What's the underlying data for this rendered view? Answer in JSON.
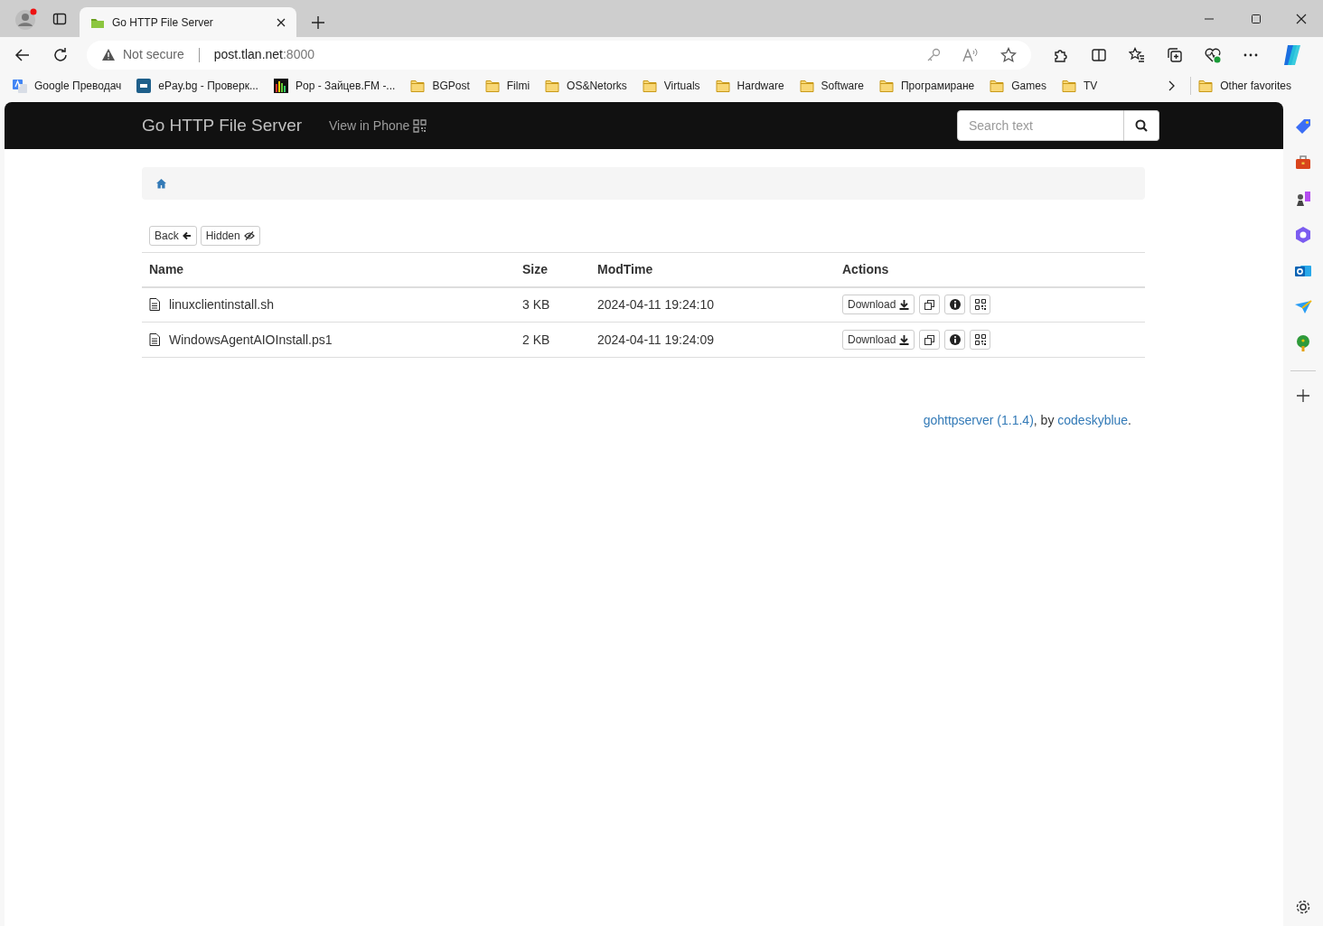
{
  "browser": {
    "tab_title": "Go HTTP File Server",
    "security": "Not secure",
    "url_host": "post.tlan.net",
    "url_port": ":8000",
    "bookmarks": [
      {
        "kind": "translate",
        "label": "Google Преводач"
      },
      {
        "kind": "epay",
        "label": "ePay.bg - Проверк..."
      },
      {
        "kind": "equalizer",
        "label": "Pop - Зайцев.FM -..."
      },
      {
        "kind": "folder",
        "label": "BGPost"
      },
      {
        "kind": "folder",
        "label": "Filmi"
      },
      {
        "kind": "folder",
        "label": "OS&Netorks"
      },
      {
        "kind": "folder",
        "label": "Virtuals"
      },
      {
        "kind": "folder",
        "label": "Hardware"
      },
      {
        "kind": "folder",
        "label": "Software"
      },
      {
        "kind": "folder",
        "label": "Програмиране"
      },
      {
        "kind": "folder",
        "label": "Games"
      },
      {
        "kind": "folder",
        "label": "TV"
      }
    ],
    "other_favorites": "Other favorites"
  },
  "navbar": {
    "brand": "Go HTTP File Server",
    "view_in_phone": "View in Phone",
    "search": {
      "placeholder": "Search text"
    }
  },
  "toolbar": [
    "Back",
    "Hidden"
  ],
  "table": {
    "columns": [
      "Name",
      "Size",
      "ModTime",
      "Actions"
    ],
    "rows": [
      {
        "name": "linuxclientinstall.sh",
        "size": "3 KB",
        "modtime": "2024-04-11 19:24:10",
        "download": "Download"
      },
      {
        "name": "WindowsAgentAIOInstall.ps1",
        "size": "2 KB",
        "modtime": "2024-04-11 19:24:09",
        "download": "Download"
      }
    ]
  },
  "footer": [
    {
      "kind": "link",
      "text": "gohttpserver (1.1.4)"
    },
    {
      "kind": "text",
      "text": ", by "
    },
    {
      "kind": "link",
      "text": "codeskyblue"
    },
    {
      "kind": "text",
      "text": "."
    }
  ]
}
